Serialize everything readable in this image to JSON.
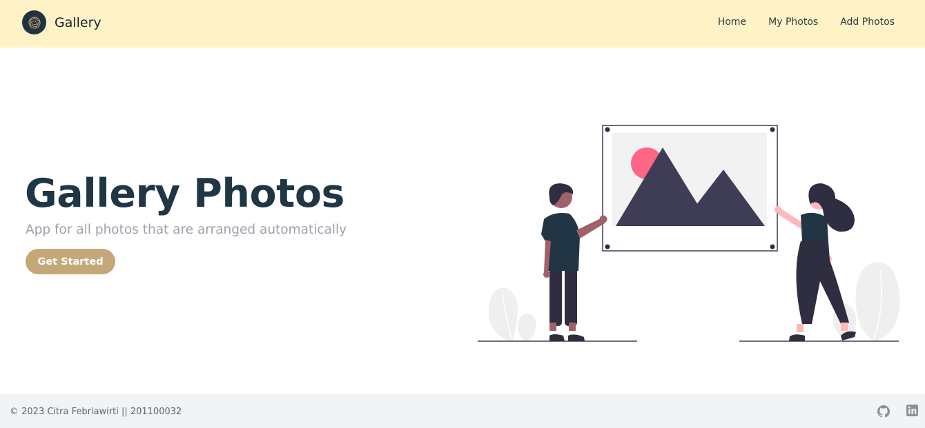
{
  "navbar": {
    "brand_name": "Gallery",
    "links": [
      {
        "label": "Home"
      },
      {
        "label": "My Photos"
      },
      {
        "label": "Add Photos"
      }
    ]
  },
  "hero": {
    "title": "Gallery Photos",
    "subtitle": "App for all photos that are arranged automatically",
    "cta_label": "Get Started"
  },
  "footer": {
    "copyright": "© 2023 Citra Febriawirti || 201100032",
    "social_icons": [
      "github-icon",
      "linkedin-icon"
    ]
  },
  "colors": {
    "navbar_bg": "#fef2c6",
    "title": "#1f3645",
    "cta": "#c4a879",
    "footer_bg": "#f2f3f5"
  }
}
